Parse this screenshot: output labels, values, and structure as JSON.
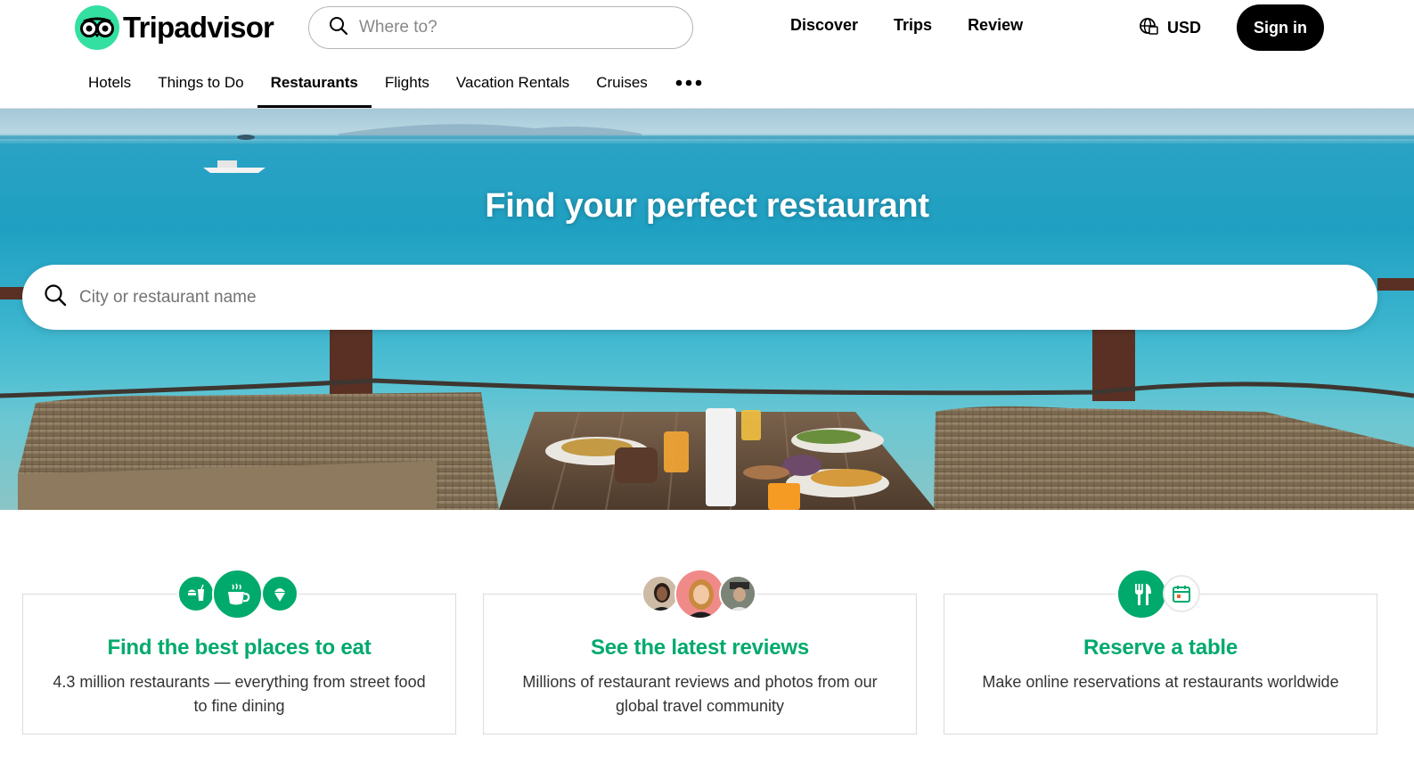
{
  "brand": {
    "name": "Tripadvisor",
    "accent": "#34e0a1",
    "green": "#00aa6c"
  },
  "header": {
    "search_placeholder": "Where to?",
    "links": [
      "Discover",
      "Trips",
      "Review"
    ],
    "currency": "USD",
    "signin_label": "Sign in",
    "icons": {
      "search": "search-icon",
      "language": "globe-icon"
    }
  },
  "tabs": [
    {
      "label": "Hotels",
      "active": false
    },
    {
      "label": "Things to Do",
      "active": false
    },
    {
      "label": "Restaurants",
      "active": true
    },
    {
      "label": "Flights",
      "active": false
    },
    {
      "label": "Vacation Rentals",
      "active": false
    },
    {
      "label": "Cruises",
      "active": false
    }
  ],
  "tab_more_icon": "more-icon",
  "hero": {
    "title": "Find your perfect restaurant",
    "search_placeholder": "City or restaurant name"
  },
  "features": [
    {
      "title": "Find the best places to eat",
      "description": "4.3 million restaurants — everything from street food to fine dining",
      "icons": [
        "fast-food-icon",
        "coffee-icon",
        "ice-cream-icon"
      ]
    },
    {
      "title": "See the latest reviews",
      "description": "Millions of restaurant reviews and photos from our global travel community",
      "icons": [
        "reviewer-avatar",
        "reviewer-avatar",
        "reviewer-avatar"
      ]
    },
    {
      "title": "Reserve a table",
      "description": "Make online reservations at restaurants worldwide",
      "icons": [
        "fork-knife-icon",
        "calendar-icon"
      ]
    }
  ]
}
